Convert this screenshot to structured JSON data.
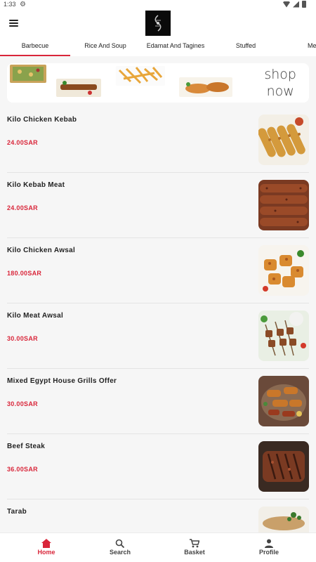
{
  "status": {
    "time": "1:33"
  },
  "tabs": [
    "Barbecue",
    "Rice And Soup",
    "Edamat And Tagines",
    "Stuffed",
    "Me"
  ],
  "banner": {
    "text_line1": "shop",
    "text_line2": "now"
  },
  "currency": "SAR",
  "items": [
    {
      "name": "Kilo Chicken Kebab",
      "price": "24.00SAR"
    },
    {
      "name": "Kilo Kebab Meat",
      "price": "24.00SAR"
    },
    {
      "name": "Kilo Chicken Awsal",
      "price": "180.00SAR"
    },
    {
      "name": "Kilo Meat Awsal",
      "price": "30.00SAR"
    },
    {
      "name": "Mixed Egypt House  Grills Offer",
      "price": "30.00SAR"
    },
    {
      "name": "Beef Steak",
      "price": "36.00SAR"
    },
    {
      "name": "Tarab",
      "price": ""
    }
  ],
  "nav": {
    "home": "Home",
    "search": "Search",
    "basket": "Basket",
    "profile": "Profile"
  },
  "colors": {
    "accent": "#d9263a",
    "background": "#f6f6f6"
  }
}
